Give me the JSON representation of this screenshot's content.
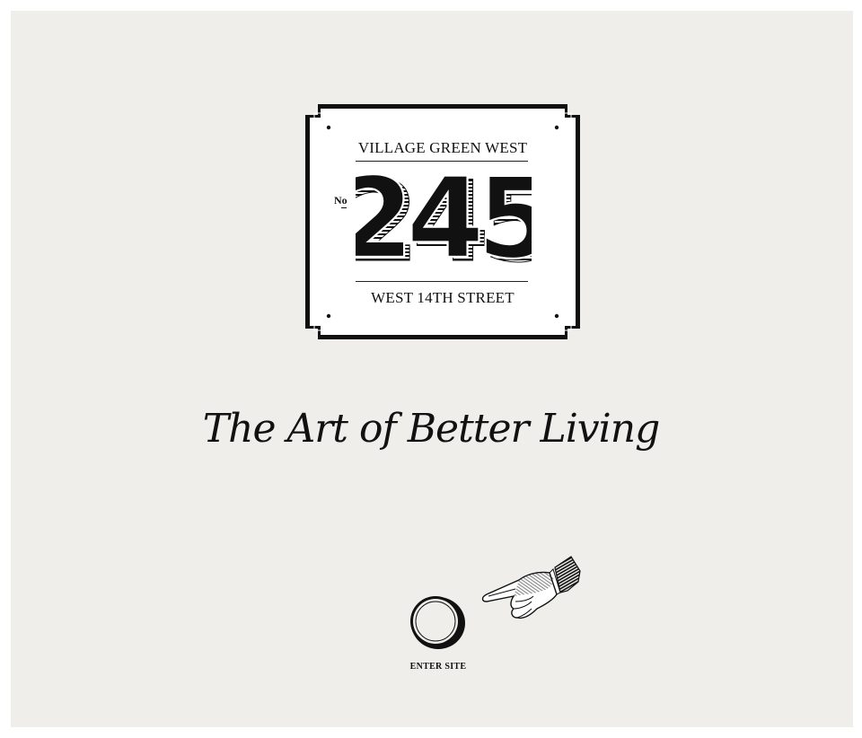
{
  "plaque": {
    "top_line": "VILLAGE GREEN WEST",
    "number_prefix": "No",
    "number": "245",
    "bottom_line": "WEST 14TH STREET"
  },
  "tagline": "The Art of Better Living",
  "enter": {
    "label": "ENTER SITE",
    "button_icon": "ring-button-icon",
    "hand_icon": "pointing-hand-icon"
  },
  "colors": {
    "background": "#efeeea",
    "border": "#ffffff",
    "ink": "#111111",
    "plaque_fill": "#ffffff"
  }
}
